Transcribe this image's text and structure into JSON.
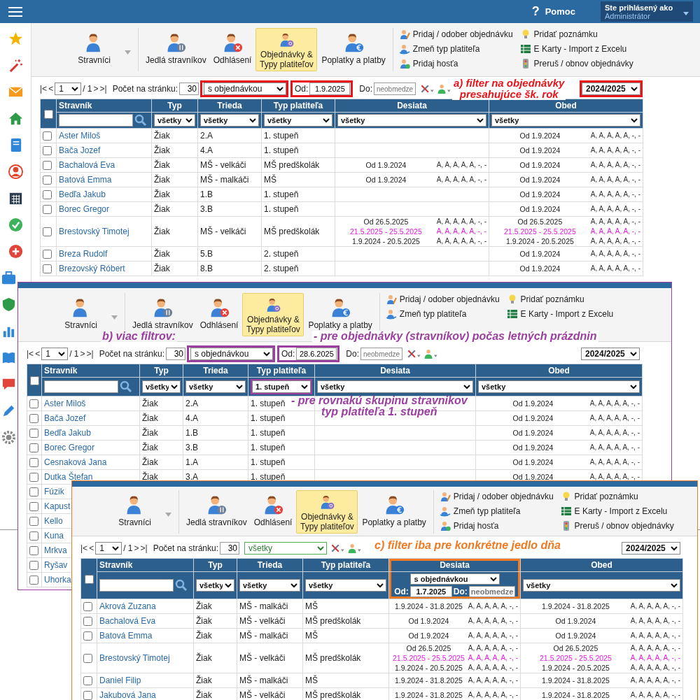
{
  "panels": [
    {
      "kind": "main",
      "color": "#e8141a",
      "header": {
        "help_icon": "?",
        "help": "Pomoc",
        "user_label": "Ste prihlásený ako",
        "user": "Administrátor"
      },
      "toolbar": {
        "buttons": [
          {
            "label": "Stravníci",
            "selected": false,
            "has_menu": true
          },
          {
            "label": "Jedlá stravníkov",
            "selected": false,
            "has_menu": false
          },
          {
            "label": "Odhlásení",
            "selected": false,
            "has_menu": false
          },
          {
            "label": "Objednávky & Typy platiteľov",
            "selected": true,
            "has_menu": false
          },
          {
            "label": "Poplatky a platby",
            "selected": false,
            "has_menu": false
          }
        ],
        "actions": [
          [
            "Pridaj / odober objednávku",
            "Zmeň typ platiteľa",
            "Pridaj hosťa"
          ],
          [
            "Pridať poznámku",
            "E Karty - Import z Excelu",
            "Preruš / obnov objednávky"
          ]
        ]
      },
      "controls": {
        "first": "|<",
        "prev": "<",
        "page": "1",
        "total": "/ 1",
        "next": ">",
        "last": ">|",
        "per_page_label": "Počet na stránku:",
        "per_page": "30",
        "filter": {
          "value": "s objednávkou",
          "kind": "default",
          "highlighted": true
        },
        "from": {
          "label": "Od:",
          "value": "1.9.2025",
          "highlighted": true
        },
        "to": {
          "label": "Do:",
          "placeholder": "neobmedze"
        },
        "year": {
          "value": "2024/2025",
          "highlighted": true
        }
      },
      "notes": [
        {
          "lines": [
            "a) filter na objednávky",
            "presahujúce šk. rok"
          ]
        }
      ],
      "table": {
        "all_checked": false,
        "columns": [
          {
            "label": "Stravník",
            "filter": {
              "kind": "search"
            }
          },
          {
            "label": "Typ",
            "filter": {
              "kind": "select",
              "value": "všetky",
              "highlighted": false
            }
          },
          {
            "label": "Trieda",
            "filter": {
              "kind": "select",
              "value": "všetky",
              "highlighted": false
            }
          },
          {
            "label": "Typ platiteľa",
            "filter": {
              "kind": "select",
              "value": "všetky",
              "highlighted": false
            }
          },
          {
            "label": "Desiata",
            "filter": {
              "kind": "select",
              "value": "všetky",
              "highlighted": false
            }
          },
          {
            "label": "Obed",
            "filter": {
              "kind": "select",
              "value": "všetky",
              "highlighted": false
            }
          }
        ],
        "rows": [
          {
            "checked": false,
            "name": "Aster Miloš",
            "type": "Žiak",
            "class": "2.A",
            "payer": "1. stupeň",
            "lunch": [
              {
                "date": "Od 1.9.2024",
                "meals": "A, A, A, A, A, -, -",
                "highlighted": false
              }
            ]
          },
          {
            "checked": false,
            "name": "Bača Jozef",
            "type": "Žiak",
            "class": "4.A",
            "payer": "1. stupeň",
            "lunch": [
              {
                "date": "Od 1.9.2024",
                "meals": "A, A, A, A, A, -, -",
                "highlighted": false
              }
            ]
          },
          {
            "checked": false,
            "name": "Bachalová Eva",
            "type": "Žiak",
            "class": "MŠ - velkáči",
            "payer": "MŠ predškolák",
            "snack": [
              {
                "date": "Od 1.9.2024",
                "meals": "A, A, A, A, A, -, -",
                "highlighted": false
              }
            ],
            "lunch": [
              {
                "date": "Od 1.9.2024",
                "meals": "A, A, A, A, A, -, -",
                "highlighted": false
              }
            ]
          },
          {
            "checked": false,
            "name": "Batová Emma",
            "type": "Žiak",
            "class": "MŠ - malkáči",
            "payer": "MŠ",
            "snack": [
              {
                "date": "Od 1.9.2024",
                "meals": "A, A, A, A, A, -, -",
                "highlighted": false
              }
            ],
            "lunch": [
              {
                "date": "Od 1.9.2024",
                "meals": "A, A, A, A, A, -, -",
                "highlighted": false
              }
            ]
          },
          {
            "checked": false,
            "name": "Bedľa Jakub",
            "type": "Žiak",
            "class": "1.B",
            "payer": "1. stupeň",
            "lunch": [
              {
                "date": "Od 1.9.2024",
                "meals": "A, A, A, A, A, -, -",
                "highlighted": false
              }
            ]
          },
          {
            "checked": false,
            "name": "Borec Gregor",
            "type": "Žiak",
            "class": "3.B",
            "payer": "1. stupeň",
            "lunch": [
              {
                "date": "Od 1.9.2024",
                "meals": "A, A, A, A, A, -, -",
                "highlighted": false
              }
            ]
          },
          {
            "checked": false,
            "name": "Brestovský Timotej",
            "type": "Žiak",
            "class": "MŠ - velkáči",
            "payer": "MŠ predškolák",
            "snack": [
              {
                "date": "Od 26.5.2025",
                "meals": "A, A, A, A, A, -, -",
                "highlighted": false
              },
              {
                "date": "21.5.2025 - 25.5.2025",
                "meals": "A, A, A, A, A, -, -",
                "highlighted": true
              },
              {
                "date": "1.9.2024 - 20.5.2025",
                "meals": "A, A, A, A, A, -, -",
                "highlighted": false
              }
            ],
            "lunch": [
              {
                "date": "Od 26.5.2025",
                "meals": "A, A, A, A, A, -, -",
                "highlighted": false
              },
              {
                "date": "21.5.2025 - 25.5.2025",
                "meals": "A, A, A, A, A, -, -",
                "highlighted": true
              },
              {
                "date": "1.9.2024 - 20.5.2025",
                "meals": "A, A, A, A, A, -, -",
                "highlighted": false
              }
            ]
          },
          {
            "checked": false,
            "name": "Breza Rudolf",
            "type": "Žiak",
            "class": "5.B",
            "payer": "2. stupeň",
            "lunch": [
              {
                "date": "Od 1.9.2024",
                "meals": "A, A, A, A, A, -, -",
                "highlighted": false
              }
            ]
          },
          {
            "checked": false,
            "name": "Brezovský Róbert",
            "type": "Žiak",
            "class": "8.B",
            "payer": "2. stupeň",
            "lunch": [
              {
                "date": "Od 1.9.2024",
                "meals": "A, A, A, A, A, -, -",
                "highlighted": false
              }
            ]
          }
        ]
      }
    },
    {
      "kind": "overlay",
      "color": "#9b3fa0",
      "toolbar": {
        "buttons": [
          {
            "label": "Stravníci",
            "selected": false,
            "has_menu": true
          },
          {
            "label": "Jedlá stravníkov",
            "selected": false,
            "has_menu": false
          },
          {
            "label": "Odhlásení",
            "selected": false,
            "has_menu": false
          },
          {
            "label": "Objednávky & Typy platiteľov",
            "selected": true,
            "has_menu": false
          },
          {
            "label": "Poplatky a platby",
            "selected": false,
            "has_menu": false
          }
        ],
        "actions": [
          [
            "Pridaj / odober objednávku",
            "Zmeň typ platiteľa"
          ],
          [
            "Pridať poznámku",
            "E Karty - Import z Excelu"
          ]
        ]
      },
      "controls": {
        "first": "|<",
        "prev": "<",
        "page": "1",
        "total": "/ 1",
        "next": ">",
        "last": ">|",
        "per_page_label": "Počet na stránku:",
        "per_page": "30",
        "filter": {
          "value": "s objednávkou",
          "kind": "default",
          "highlighted": true
        },
        "from": {
          "label": "Od:",
          "value": "28.6.2025",
          "highlighted": true
        },
        "to": {
          "label": "Do:",
          "placeholder": "neobmedze"
        },
        "year": {
          "value": "2024/2025",
          "highlighted": false
        }
      },
      "notes": [
        {
          "lines": [
            "b) viac filtrov:"
          ]
        },
        {
          "lines": [
            "- pre objednávky (stravníkov) počas letných prázdnin"
          ]
        },
        {
          "lines": [
            "- pre rovnakú skupinu stravnikov",
            "typ platiteľa 1. stupeň"
          ]
        }
      ],
      "table": {
        "all_checked": false,
        "columns": [
          {
            "label": "Stravník",
            "filter": {
              "kind": "search"
            }
          },
          {
            "label": "Typ",
            "filter": {
              "kind": "select",
              "value": "všetky",
              "highlighted": false
            }
          },
          {
            "label": "Trieda",
            "filter": {
              "kind": "select",
              "value": "všetky",
              "highlighted": false
            }
          },
          {
            "label": "Typ platiteľa",
            "filter": {
              "kind": "select",
              "value": "1. stupeň",
              "highlighted": true
            }
          },
          {
            "label": "Desiata",
            "filter": {
              "kind": "select",
              "value": "všetky",
              "highlighted": false
            }
          },
          {
            "label": "Obed",
            "filter": {
              "kind": "select",
              "value": "všetky",
              "highlighted": false
            }
          }
        ],
        "rows": [
          {
            "checked": false,
            "name": "Aster Miloš",
            "type": "Žiak",
            "class": "2.A",
            "payer": "1. stupeň",
            "lunch": [
              {
                "date": "Od 1.9.2024",
                "meals": "A, A, A, A, A, -, -",
                "highlighted": false
              }
            ]
          },
          {
            "checked": false,
            "name": "Bača Jozef",
            "type": "Žiak",
            "class": "4.A",
            "payer": "1. stupeň",
            "lunch": [
              {
                "date": "Od 1.9.2024",
                "meals": "A, A, A, A, A, -, -",
                "highlighted": false
              }
            ]
          },
          {
            "checked": false,
            "name": "Bedľa Jakub",
            "type": "Žiak",
            "class": "1.B",
            "payer": "1. stupeň",
            "lunch": [
              {
                "date": "Od 1.9.2024",
                "meals": "A, A, A, A, A, -, -",
                "highlighted": false
              }
            ]
          },
          {
            "checked": false,
            "name": "Borec Gregor",
            "type": "Žiak",
            "class": "3.B",
            "payer": "1. stupeň",
            "lunch": [
              {
                "date": "Od 1.9.2024",
                "meals": "A, A, A, A, A, -, -",
                "highlighted": false
              }
            ]
          },
          {
            "checked": false,
            "name": "Cesnaková Jana",
            "type": "Žiak",
            "class": "1.A",
            "payer": "1. stupeň",
            "lunch": [
              {
                "date": "Od 1.9.2024",
                "meals": "A, A, A, A, A, -, -",
                "highlighted": false
              }
            ]
          },
          {
            "checked": false,
            "name": "Dutka Štefan",
            "type": "Žiak",
            "class": "3.A",
            "payer": "1. stupeň",
            "lunch": [
              {
                "date": "Od 1.9.2024",
                "meals": "A, A, A, A, A, -, -",
                "highlighted": false
              }
            ]
          },
          {
            "checked": false,
            "name": "Fúzik"
          },
          {
            "checked": false,
            "name": "Kapust"
          },
          {
            "checked": false,
            "name": "Kello"
          },
          {
            "checked": false,
            "name": "Kuna"
          },
          {
            "checked": false,
            "name": "Mrkva"
          },
          {
            "checked": false,
            "name": "Ryšav"
          },
          {
            "checked": false,
            "name": "Uhorka"
          }
        ]
      }
    },
    {
      "kind": "overlay",
      "color": "#f07a23",
      "toolbar": {
        "buttons": [
          {
            "label": "Stravníci",
            "selected": false,
            "has_menu": true
          },
          {
            "label": "Jedlá stravníkov",
            "selected": false,
            "has_menu": false
          },
          {
            "label": "Odhlásení",
            "selected": false,
            "has_menu": false
          },
          {
            "label": "Objednávky & Typy platiteľov",
            "selected": true,
            "has_menu": false
          },
          {
            "label": "Poplatky a platby",
            "selected": false,
            "has_menu": false
          }
        ],
        "actions": [
          [
            "Pridaj / odober objednávku",
            "Zmeň typ platiteľa",
            "Pridaj hosťa"
          ],
          [
            "Pridať poznámku",
            "E Karty - Import z Excelu",
            "Preruš / obnov objednávky"
          ]
        ]
      },
      "controls": {
        "first": "|<",
        "prev": "<",
        "page": "1",
        "total": "/ 1",
        "next": ">",
        "last": ">|",
        "per_page_label": "Počet na stránku:",
        "per_page": "30",
        "filter": {
          "value": "všetky",
          "kind": "success",
          "highlighted": false
        },
        "year": {
          "value": "2024/2025",
          "highlighted": false
        }
      },
      "notes": [
        {
          "lines": [
            "c) filter iba pre konkrétne jedlo dňa"
          ]
        }
      ],
      "table": {
        "all_checked": false,
        "columns": [
          {
            "label": "Stravník",
            "filter": {
              "kind": "search"
            }
          },
          {
            "label": "Typ",
            "filter": {
              "kind": "select",
              "value": "všetky",
              "highlighted": false
            }
          },
          {
            "label": "Trieda",
            "filter": {
              "kind": "select",
              "value": "všetky",
              "highlighted": false
            }
          },
          {
            "label": "Typ platiteľa",
            "filter": {
              "kind": "select",
              "value": "všetky",
              "highlighted": false
            }
          },
          {
            "label": "Desiata",
            "filter": {
              "kind": "order",
              "value": "s objednávkou",
              "from_label": "Od:",
              "from": "1.7.2025",
              "to_label": "Do:",
              "to_placeholder": "neobmedze",
              "highlighted": true
            }
          },
          {
            "label": "Obed",
            "filter": {
              "kind": "select",
              "value": "všetky",
              "highlighted": false
            }
          }
        ],
        "rows": [
          {
            "checked": false,
            "name": "Akrová Zuzana",
            "type": "Žiak",
            "class": "MŠ - malkáči",
            "payer": "MŠ",
            "snack": [
              {
                "date": "1.9.2024 - 31.8.2025",
                "meals": "A, A, A, A, A, -, -",
                "highlighted": false
              }
            ],
            "lunch": [
              {
                "date": "1.9.2024 - 31.8.2025",
                "meals": "A, A, A, A, A, -, -",
                "highlighted": false
              }
            ]
          },
          {
            "checked": false,
            "name": "Bachalová Eva",
            "type": "Žiak",
            "class": "MŠ - velkáči",
            "payer": "MŠ predškolák",
            "snack": [
              {
                "date": "Od 1.9.2024",
                "meals": "A, A, A, A, A, -, -",
                "highlighted": false
              }
            ],
            "lunch": [
              {
                "date": "Od 1.9.2024",
                "meals": "A, A, A, A, A, -, -",
                "highlighted": false
              }
            ]
          },
          {
            "checked": false,
            "name": "Batová Emma",
            "type": "Žiak",
            "class": "MŠ - malkáči",
            "payer": "MŠ",
            "snack": [
              {
                "date": "Od 1.9.2024",
                "meals": "A, A, A, A, A, -, -",
                "highlighted": false
              }
            ],
            "lunch": [
              {
                "date": "Od 1.9.2024",
                "meals": "A, A, A, A, A, -, -",
                "highlighted": false
              }
            ]
          },
          {
            "checked": false,
            "name": "Brestovský Timotej",
            "type": "Žiak",
            "class": "MŠ - velkáči",
            "payer": "MŠ predškolák",
            "snack": [
              {
                "date": "Od 26.5.2025",
                "meals": "A, A, A, A, A, -, -",
                "highlighted": false
              },
              {
                "date": "21.5.2025 - 25.5.2025",
                "meals": "A, A, A, A, A, -, -",
                "highlighted": true
              },
              {
                "date": "1.9.2024 - 20.5.2025",
                "meals": "A, A, A, A, A, -, -",
                "highlighted": false
              }
            ],
            "lunch": [
              {
                "date": "Od 26.5.2025",
                "meals": "A, A, A, A, A, -, -",
                "highlighted": false
              },
              {
                "date": "21.5.2025 - 25.5.2025",
                "meals": "A, A, A, A, A, -, -",
                "highlighted": true
              },
              {
                "date": "1.9.2024 - 20.5.2025",
                "meals": "A, A, A, A, A, -, -",
                "highlighted": false
              }
            ]
          },
          {
            "checked": false,
            "name": "Daniel Filip",
            "type": "Žiak",
            "class": "MŠ - malkáči",
            "payer": "MŠ",
            "snack": [
              {
                "date": "1.9.2024 - 31.8.2025",
                "meals": "A, A, A, A, A, -, -",
                "highlighted": false
              }
            ],
            "lunch": [
              {
                "date": "1.9.2024 - 31.8.2025",
                "meals": "A, A, A, A, A, -, -",
                "highlighted": false
              }
            ]
          },
          {
            "checked": false,
            "name": "Jakubová Jana",
            "type": "Žiak",
            "class": "MŠ - velkáči",
            "payer": "MŠ predškolák",
            "snack": [
              {
                "date": "1.9.2024 - 31.8.2025",
                "meals": "A, A, A, A, A, -, -",
                "highlighted": false
              }
            ],
            "lunch": [
              {
                "date": "1.9.2024 - 31.8.2025",
                "meals": "A, A, A, A, A, -, -",
                "highlighted": false
              }
            ]
          }
        ]
      }
    }
  ]
}
